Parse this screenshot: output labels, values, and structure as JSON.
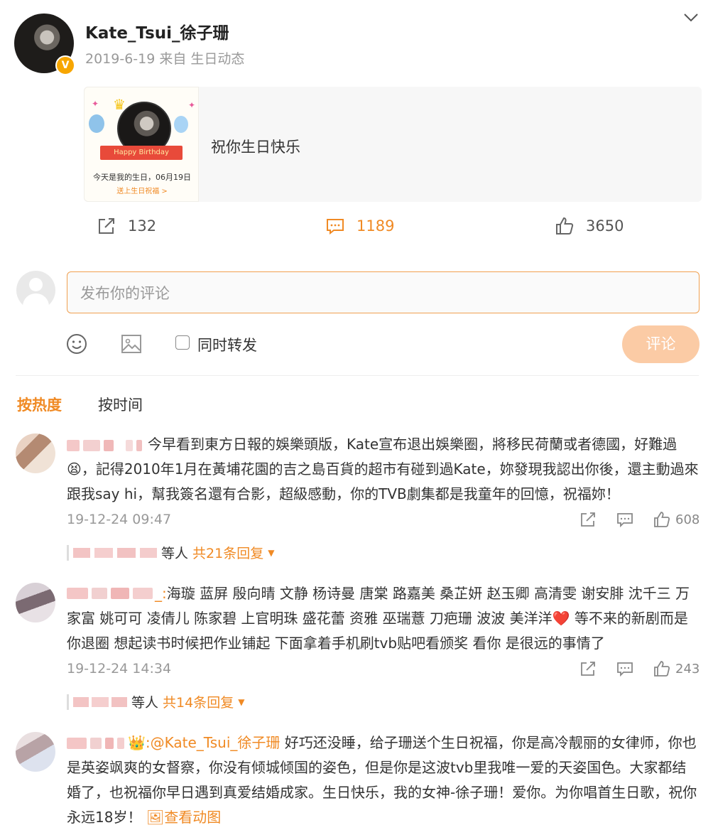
{
  "post": {
    "username": "Kate_Tsui_徐子珊",
    "date": "2019-6-19",
    "source": "来自 生日动态",
    "card": {
      "image_text": "今天是我的生日，06月19日",
      "image_link": "送上生日祝福 >",
      "ribbon": "Happy Birthday",
      "text": "祝你生日快乐"
    },
    "actions": {
      "repost_count": "132",
      "comment_count": "1189",
      "like_count": "3650"
    }
  },
  "composer": {
    "placeholder": "发布你的评论",
    "forward_label": "同时转发",
    "submit_label": "评论"
  },
  "sort": {
    "hot_label": "按热度",
    "time_label": "按时间"
  },
  "comments": [
    {
      "text": "今早看到東方日報的娛樂頭版，Kate宣布退出娛樂圈，將移民荷蘭或者德國，好難過😫，記得2010年1月在黃埔花園的吉之島百貨的超市有碰到過Kate，妳發現我認出你後，還主動過來跟我say hi，幫我簽名還有合影，超級感動，你的TVB劇集都是我童年的回憶，祝福妳！",
      "time": "19-12-24 09:47",
      "likes": "608",
      "reply_suffix": "等人",
      "reply_count": "共21条回复"
    },
    {
      "text_prefix": "_:",
      "text": "海璇 蓝屏 殷向晴 文静 杨诗曼 唐棠 路嘉美 桑芷妍 赵玉卿 高清雯 谢安腓 沈千三 万家富 姚可可 凌倩儿 陈家碧 上官明珠 盛花蕾 资雅 巫瑞薏 刀疤珊 波波 美洋洋❤️ 等不来的新剧而是你退圈 想起读书时候把作业铺起 下面拿着手机刷tvb贴吧看颁奖 看你 是很远的事情了",
      "time": "19-12-24 14:34",
      "likes": "243",
      "reply_suffix": "等人",
      "reply_count": "共14条回复"
    },
    {
      "badge": "👑",
      "mention": ":@Kate_Tsui_徐子珊",
      "text": " 好巧还没睡，给子珊送个生日祝福，你是高冷靓丽的女律师，你也是英姿飒爽的女督察，你没有倾城倾国的姿色，但是你是这波tvb里我唯一爱的天姿国色。大家都结婚了，也祝福你早日遇到真爱结婚成家。生日快乐，我的女神-徐子珊！爱你。为你唱首生日歌，祝你永远18岁！",
      "gif_label": "🖼查看动图"
    }
  ],
  "colors": {
    "accent": "#f08a24",
    "verified": "#f7a600",
    "submit_disabled": "#fbcba5"
  }
}
